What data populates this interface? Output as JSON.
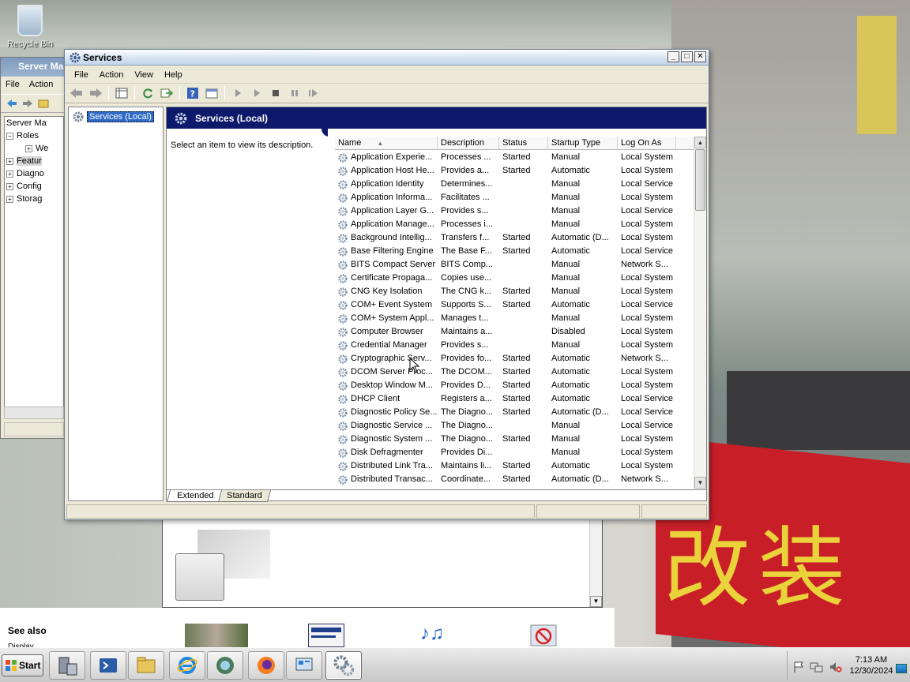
{
  "desktop": {
    "recycle_bin_label": "Recycle Bin",
    "wallpaper_text": "改装"
  },
  "server_manager": {
    "title": "Server Ma",
    "menu": [
      "File",
      "Action"
    ],
    "tree": [
      {
        "label": "Server Ma",
        "toggle": ""
      },
      {
        "label": "Roles",
        "toggle": "−"
      },
      {
        "label": "We",
        "toggle": "+"
      },
      {
        "label": "Featur",
        "toggle": "+"
      },
      {
        "label": "Diagno",
        "toggle": "+"
      },
      {
        "label": "Config",
        "toggle": "+"
      },
      {
        "label": "Storag",
        "toggle": "+"
      }
    ]
  },
  "background_page": {
    "see_also": "See also",
    "display_link": "Display"
  },
  "services": {
    "window_title": "Services",
    "menu": [
      "File",
      "Action",
      "View",
      "Help"
    ],
    "tree_node": "Services (Local)",
    "banner_title": "Services (Local)",
    "description_prompt": "Select an item to view its description.",
    "columns": {
      "name": "Name",
      "description": "Description",
      "status": "Status",
      "startup_type": "Startup Type",
      "log_on_as": "Log On As"
    },
    "rows": [
      {
        "name": "Application Experie...",
        "description": "Processes ...",
        "status": "Started",
        "startup": "Manual",
        "logon": "Local System"
      },
      {
        "name": "Application Host He...",
        "description": "Provides a...",
        "status": "Started",
        "startup": "Automatic",
        "logon": "Local System"
      },
      {
        "name": "Application Identity",
        "description": "Determines...",
        "status": "",
        "startup": "Manual",
        "logon": "Local Service"
      },
      {
        "name": "Application Informa...",
        "description": "Facilitates ...",
        "status": "",
        "startup": "Manual",
        "logon": "Local System"
      },
      {
        "name": "Application Layer G...",
        "description": "Provides s...",
        "status": "",
        "startup": "Manual",
        "logon": "Local Service"
      },
      {
        "name": "Application Manage...",
        "description": "Processes i...",
        "status": "",
        "startup": "Manual",
        "logon": "Local System"
      },
      {
        "name": "Background Intellig...",
        "description": "Transfers f...",
        "status": "Started",
        "startup": "Automatic (D...",
        "logon": "Local System"
      },
      {
        "name": "Base Filtering Engine",
        "description": "The Base F...",
        "status": "Started",
        "startup": "Automatic",
        "logon": "Local Service"
      },
      {
        "name": "BITS Compact Server",
        "description": "BITS Comp...",
        "status": "",
        "startup": "Manual",
        "logon": "Network S..."
      },
      {
        "name": "Certificate Propaga...",
        "description": "Copies use...",
        "status": "",
        "startup": "Manual",
        "logon": "Local System"
      },
      {
        "name": "CNG Key Isolation",
        "description": "The CNG k...",
        "status": "Started",
        "startup": "Manual",
        "logon": "Local System"
      },
      {
        "name": "COM+ Event System",
        "description": "Supports S...",
        "status": "Started",
        "startup": "Automatic",
        "logon": "Local Service"
      },
      {
        "name": "COM+ System Appl...",
        "description": "Manages t...",
        "status": "",
        "startup": "Manual",
        "logon": "Local System"
      },
      {
        "name": "Computer Browser",
        "description": "Maintains a...",
        "status": "",
        "startup": "Disabled",
        "logon": "Local System"
      },
      {
        "name": "Credential Manager",
        "description": "Provides s...",
        "status": "",
        "startup": "Manual",
        "logon": "Local System"
      },
      {
        "name": "Cryptographic Serv...",
        "description": "Provides fo...",
        "status": "Started",
        "startup": "Automatic",
        "logon": "Network S..."
      },
      {
        "name": "DCOM Server Proc...",
        "description": "The DCOM...",
        "status": "Started",
        "startup": "Automatic",
        "logon": "Local System"
      },
      {
        "name": "Desktop Window M...",
        "description": "Provides D...",
        "status": "Started",
        "startup": "Automatic",
        "logon": "Local System"
      },
      {
        "name": "DHCP Client",
        "description": "Registers a...",
        "status": "Started",
        "startup": "Automatic",
        "logon": "Local Service"
      },
      {
        "name": "Diagnostic Policy Se...",
        "description": "The Diagno...",
        "status": "Started",
        "startup": "Automatic (D...",
        "logon": "Local Service"
      },
      {
        "name": "Diagnostic Service ...",
        "description": "The Diagno...",
        "status": "",
        "startup": "Manual",
        "logon": "Local Service"
      },
      {
        "name": "Diagnostic System ...",
        "description": "The Diagno...",
        "status": "Started",
        "startup": "Manual",
        "logon": "Local System"
      },
      {
        "name": "Disk Defragmenter",
        "description": "Provides Di...",
        "status": "",
        "startup": "Manual",
        "logon": "Local System"
      },
      {
        "name": "Distributed Link Tra...",
        "description": "Maintains li...",
        "status": "Started",
        "startup": "Automatic",
        "logon": "Local System"
      },
      {
        "name": "Distributed Transac...",
        "description": "Coordinate...",
        "status": "Started",
        "startup": "Automatic (D...",
        "logon": "Network S..."
      }
    ],
    "tabs": [
      "Extended",
      "Standard"
    ]
  },
  "taskbar": {
    "start_label": "Start",
    "buttons": [
      "server-manager-icon",
      "powershell-icon",
      "explorer-icon",
      "ie-icon",
      "media-center-icon",
      "firefox-icon",
      "control-panel-icon",
      "services-icon"
    ],
    "time": "7:13 AM",
    "date": "12/30/2024"
  },
  "colors": {
    "banner": "#0d1a6b",
    "selection": "#316ac5",
    "window_frame": "#ece9d8"
  }
}
